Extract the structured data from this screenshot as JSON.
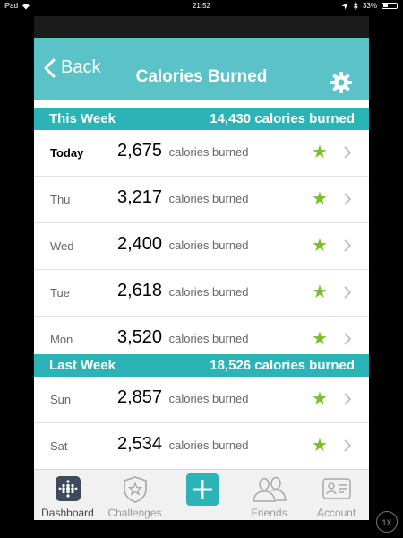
{
  "status_bar": {
    "device": "iPad",
    "time": "21:52",
    "battery": "33%",
    "battery_level": 0.33
  },
  "nav": {
    "back_label": "Back",
    "title": "Calories Burned",
    "settings_icon": "gear-icon"
  },
  "this_week": {
    "title": "This Week",
    "total": "14,430 calories burned",
    "rows": [
      {
        "day": "Today",
        "value": "2,675",
        "unit": "calories burned"
      },
      {
        "day": "Thu",
        "value": "3,217",
        "unit": "calories burned"
      },
      {
        "day": "Wed",
        "value": "2,400",
        "unit": "calories burned"
      },
      {
        "day": "Tue",
        "value": "2,618",
        "unit": "calories burned"
      },
      {
        "day": "Mon",
        "value": "3,520",
        "unit": "calories burned"
      }
    ]
  },
  "last_week": {
    "title": "Last Week",
    "total": "18,526 calories burned",
    "rows": [
      {
        "day": "Sun",
        "value": "2,857",
        "unit": "calories burned"
      },
      {
        "day": "Sat",
        "value": "2,534",
        "unit": "calories burned"
      }
    ]
  },
  "tabs": [
    {
      "label": "Dashboard",
      "icon": "dashboard-icon"
    },
    {
      "label": "Challenges",
      "icon": "challenges-icon"
    },
    {
      "label": "",
      "icon": "add-icon"
    },
    {
      "label": "Friends",
      "icon": "friends-icon"
    },
    {
      "label": "Account",
      "icon": "account-icon"
    }
  ],
  "zoom_badge": "1X",
  "colors": {
    "navbar": "#5bc2c7",
    "section": "#2bb3b6",
    "star": "#7cbf2a"
  }
}
